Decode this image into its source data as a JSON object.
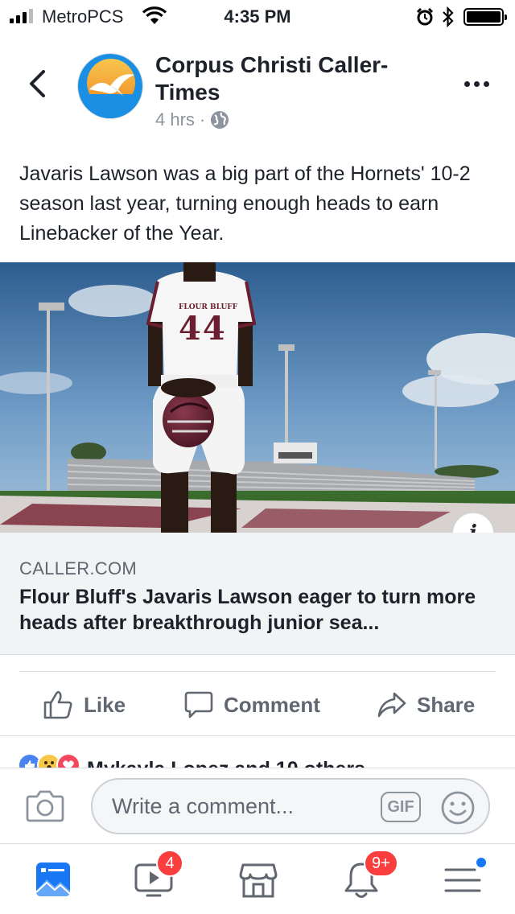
{
  "status_bar": {
    "carrier": "MetroPCS",
    "time": "4:35 PM",
    "battery_level": 1.0
  },
  "post": {
    "page_name": "Corpus Christi Caller-Times",
    "timestamp": "4 hrs",
    "meta_separator": "·",
    "privacy_icon": "globe-icon",
    "text": "Javaris Lawson was a big part of the Hornets' 10-2 season last year, turning enough heads to earn Linebacker of the Year.",
    "image": {
      "jersey_text": "FLOUR BLUFF",
      "jersey_number": "44"
    },
    "info_button_label": "i",
    "link": {
      "domain": "CALLER.COM",
      "title": "Flour Bluff's Javaris Lawson eager to turn more heads after breakthrough junior sea..."
    }
  },
  "actions": {
    "like_label": "Like",
    "comment_label": "Comment",
    "share_label": "Share"
  },
  "reactions": {
    "summary": "Mykayla Lopez and 10 others"
  },
  "composer": {
    "placeholder": "Write a comment...",
    "gif_label": "GIF"
  },
  "tab_bar": {
    "items": [
      {
        "name": "News Feed",
        "icon": "news-feed-icon"
      },
      {
        "name": "Watch",
        "icon": "watch-icon",
        "badge": "4"
      },
      {
        "name": "Marketplace",
        "icon": "marketplace-icon"
      },
      {
        "name": "Notifications",
        "icon": "bell-icon",
        "badge": "9+"
      },
      {
        "name": "Menu",
        "icon": "menu-icon"
      }
    ]
  },
  "colors": {
    "facebook_blue": "#1877f2",
    "badge_red": "#fa3e3e",
    "secondary_text": "#606770"
  }
}
